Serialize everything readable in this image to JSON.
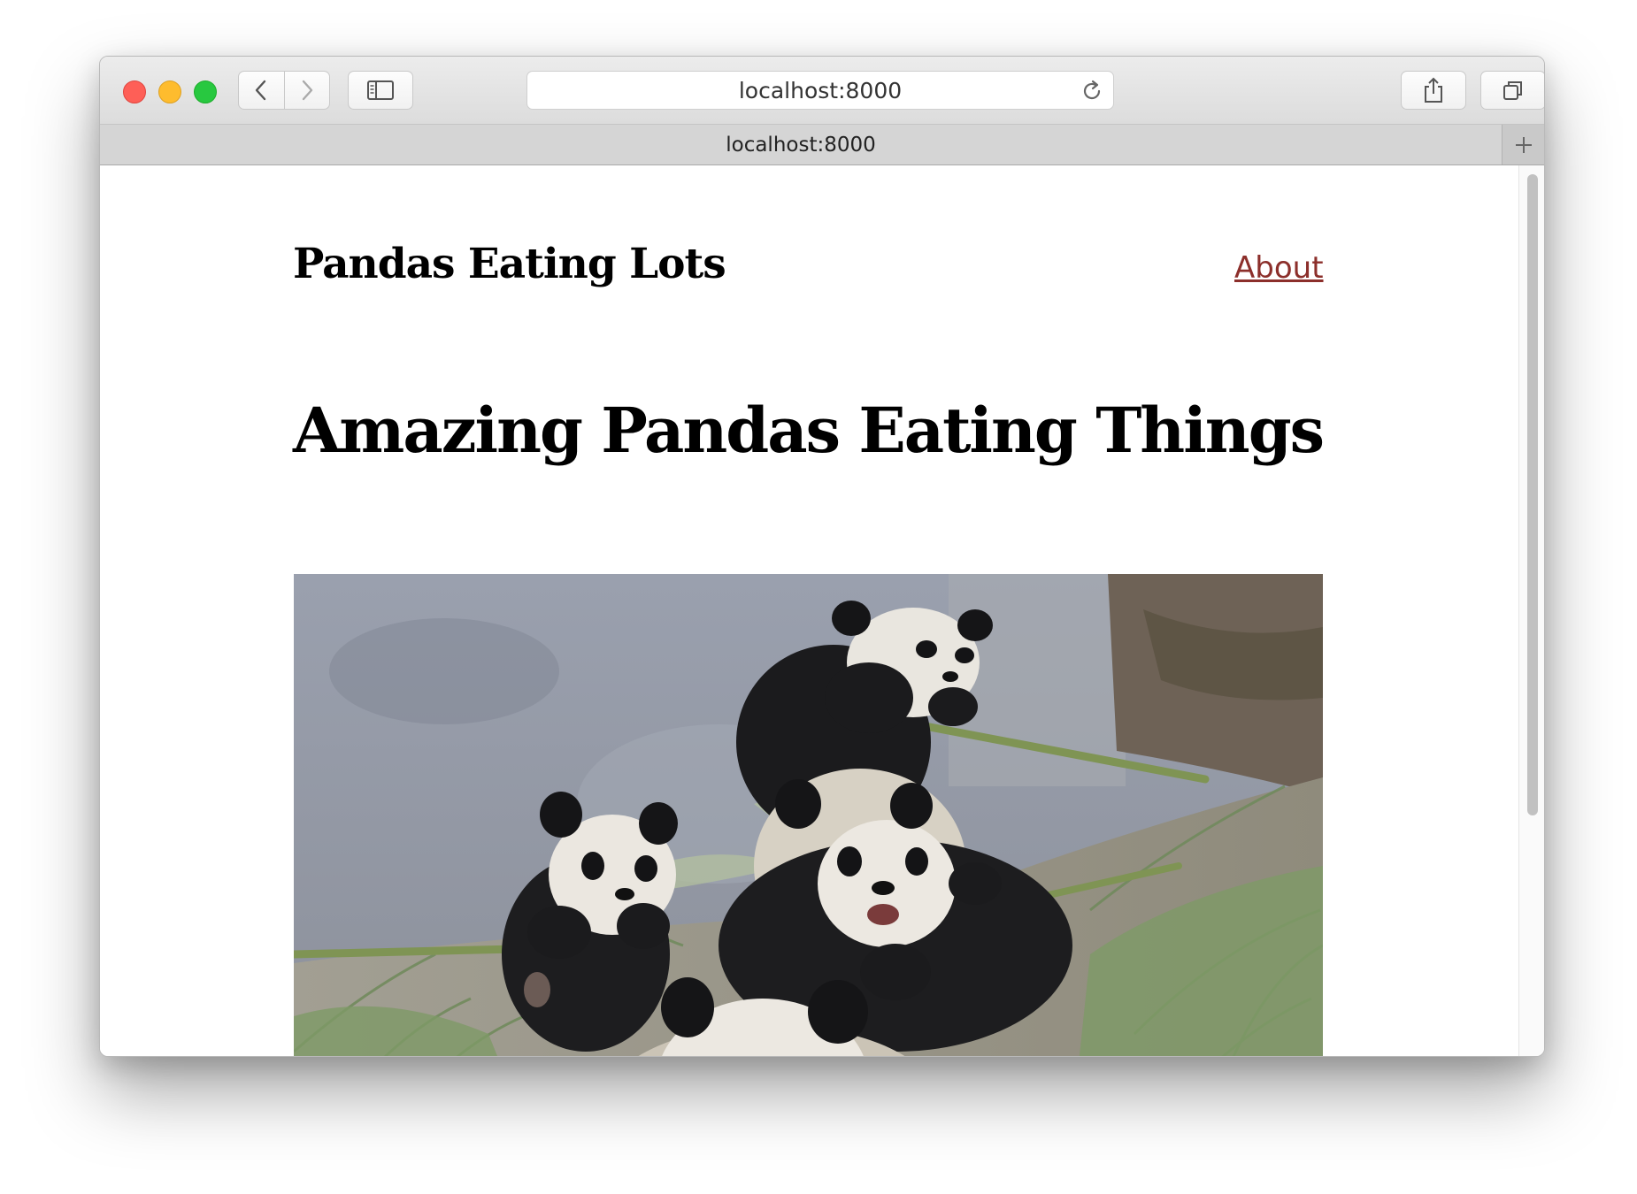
{
  "browser": {
    "url": "localhost:8000",
    "tab_title": "localhost:8000",
    "icons": [
      "close-light",
      "minimize-light",
      "zoom-light",
      "back-icon",
      "forward-icon",
      "sidebar-icon",
      "reload-icon",
      "share-icon",
      "tabs-icon",
      "plus-icon"
    ]
  },
  "site": {
    "title": "Pandas Eating Lots",
    "nav": {
      "about_label": "About"
    }
  },
  "page": {
    "heading": "Amazing Pandas Eating Things"
  },
  "colors": {
    "link": "#8c2f2b",
    "text": "#000000"
  }
}
